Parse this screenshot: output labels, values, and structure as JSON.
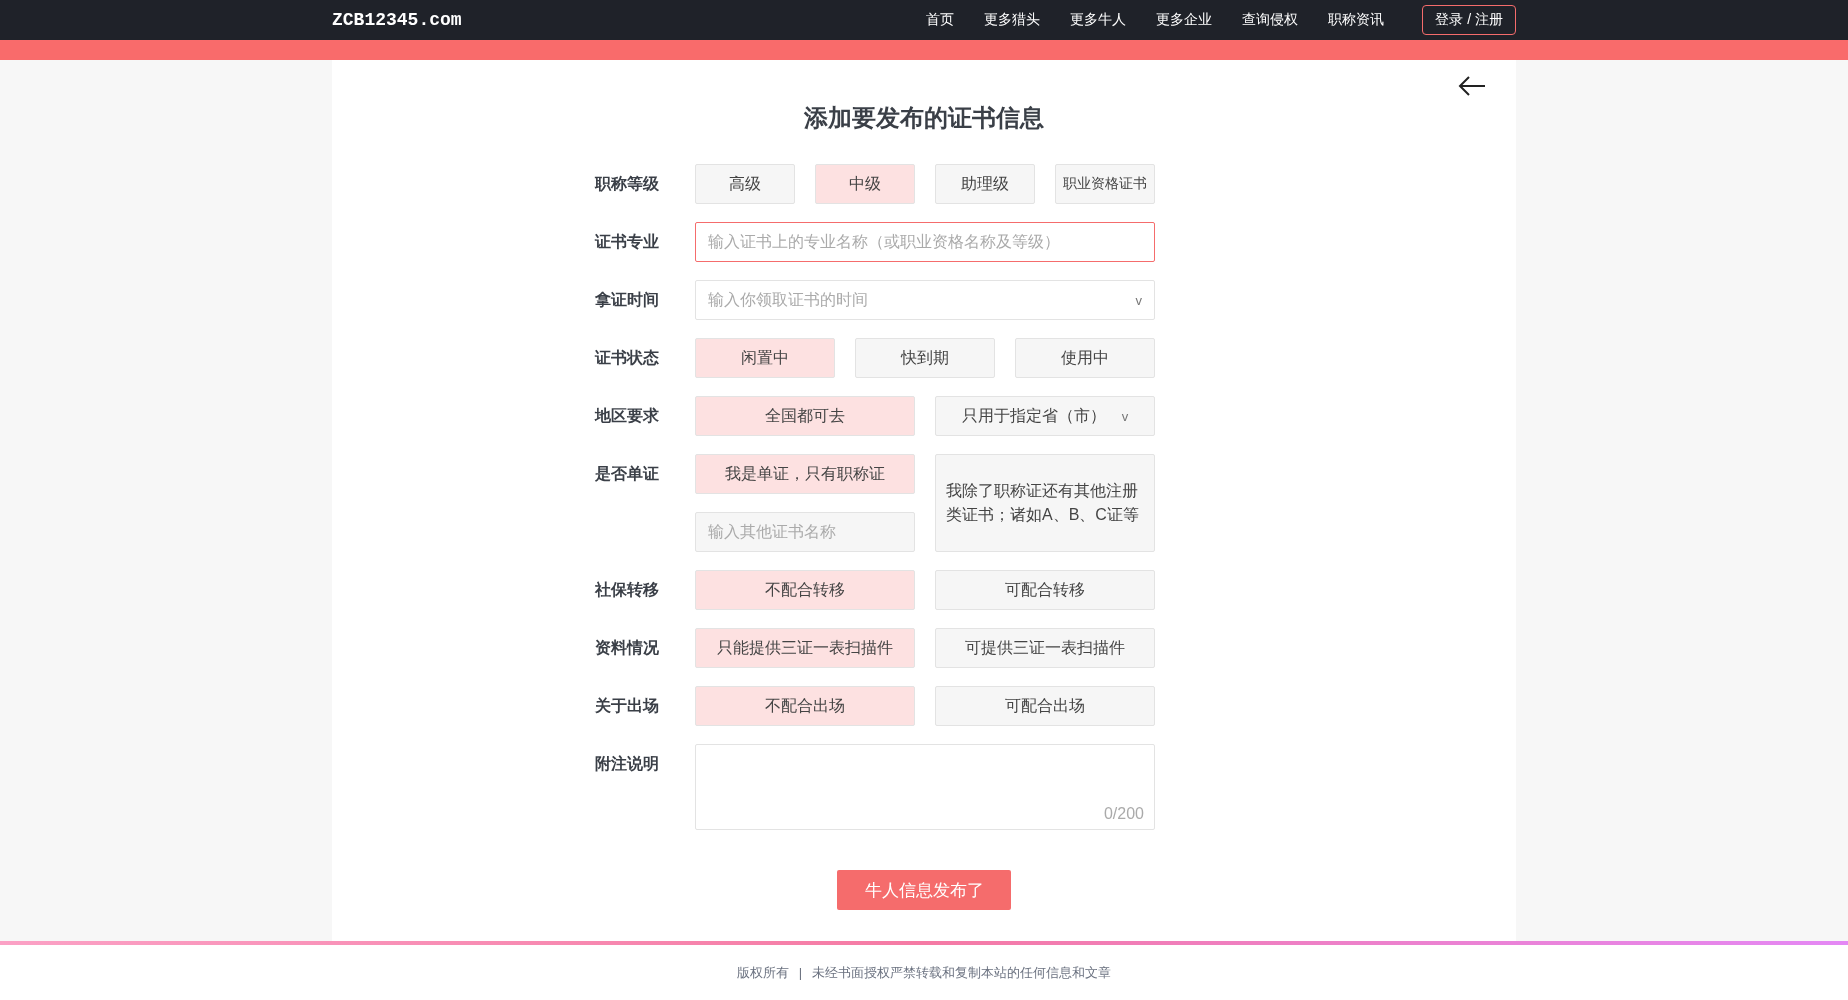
{
  "header": {
    "logo": "ZCB12345.com",
    "nav": [
      {
        "label": "首页"
      },
      {
        "label": "更多猎头"
      },
      {
        "label": "更多牛人"
      },
      {
        "label": "更多企业"
      },
      {
        "label": "查询侵权"
      },
      {
        "label": "职称资讯"
      }
    ],
    "login": "登录 / 注册"
  },
  "form": {
    "title": "添加要发布的证书信息",
    "rows": [
      {
        "kind": "options",
        "label": "职称等级",
        "options": [
          {
            "kind": "option",
            "text": "高级",
            "selected": false
          },
          {
            "kind": "option",
            "text": "中级",
            "selected": true
          },
          {
            "kind": "option",
            "text": "助理级",
            "selected": false
          },
          {
            "kind": "option",
            "text": "职业资格证书",
            "selected": false
          }
        ]
      },
      {
        "kind": "input",
        "label": "证书专业",
        "placeholder": "输入证书上的专业名称（或职业资格名称及等级）",
        "focused": true
      },
      {
        "kind": "select",
        "label": "拿证时间",
        "placeholder": "输入你领取证书的时间",
        "caret": "v"
      },
      {
        "kind": "options",
        "label": "证书状态",
        "options": [
          {
            "kind": "option",
            "text": "闲置中",
            "selected": true
          },
          {
            "kind": "option",
            "text": "快到期",
            "selected": false
          },
          {
            "kind": "option",
            "text": "使用中",
            "selected": false
          }
        ]
      },
      {
        "kind": "options",
        "label": "地区要求",
        "options": [
          {
            "kind": "option",
            "text": "全国都可去",
            "selected": true
          },
          {
            "kind": "dropdown",
            "text": "只用于指定省（市）",
            "caret": "v",
            "selected": false
          }
        ]
      },
      {
        "kind": "single",
        "label": "是否单证",
        "options": [
          {
            "text": "我是单证，只有职称证",
            "selected": true
          },
          {
            "text": "我除了职称证还有其他注册类证书；诸如A、B、C证等",
            "selected": false
          }
        ],
        "placeholder": "输入其他证书名称"
      },
      {
        "kind": "options",
        "label": "社保转移",
        "options": [
          {
            "kind": "option",
            "text": "不配合转移",
            "selected": true
          },
          {
            "kind": "option",
            "text": "可配合转移",
            "selected": false
          }
        ]
      },
      {
        "kind": "options",
        "label": "资料情况",
        "options": [
          {
            "kind": "option",
            "text": "只能提供三证一表扫描件",
            "selected": true
          },
          {
            "kind": "option",
            "text": "可提供三证一表扫描件",
            "selected": false
          }
        ]
      },
      {
        "kind": "options",
        "label": "关于出场",
        "options": [
          {
            "kind": "option",
            "text": "不配合出场",
            "selected": true
          },
          {
            "kind": "option",
            "text": "可配合出场",
            "selected": false
          }
        ]
      },
      {
        "kind": "textarea",
        "label": "附注说明",
        "counter": "0/200"
      }
    ],
    "submit": "牛人信息发布了"
  },
  "footer": {
    "items": [
      "版权所有",
      "|",
      "未经书面授权严禁转载和复制本站的任何信息和文章"
    ]
  }
}
